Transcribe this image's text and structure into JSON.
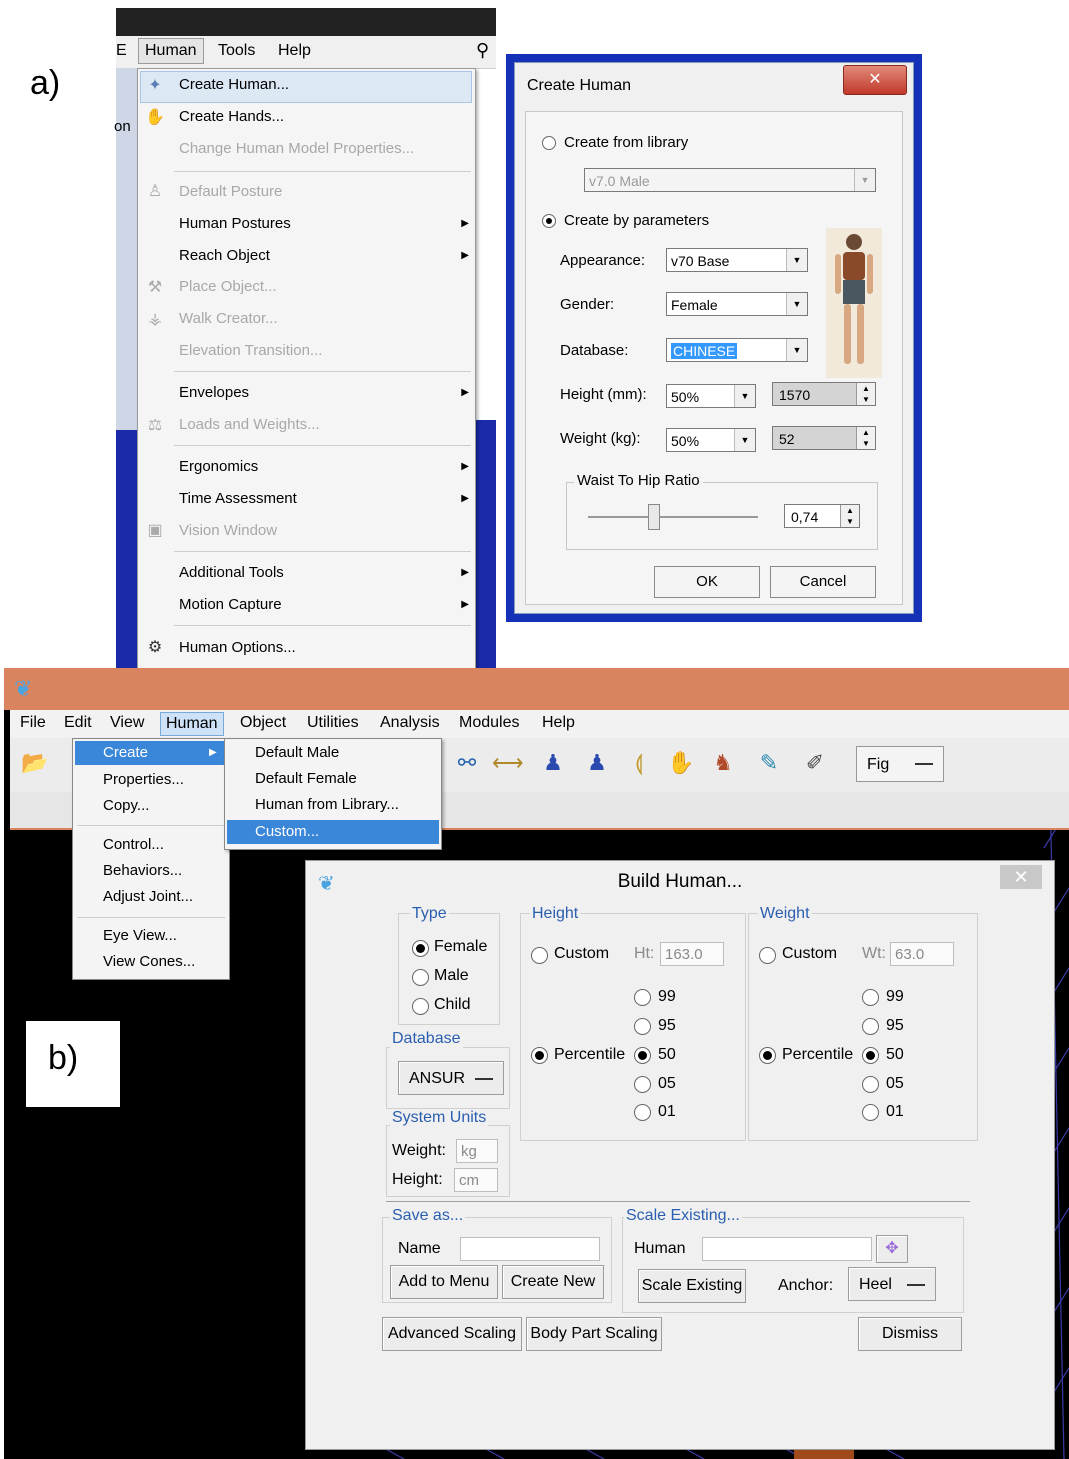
{
  "labels": {
    "a": "a)",
    "b": "b)"
  },
  "a": {
    "menubar": {
      "left_fragment": "E",
      "human": "Human",
      "tools": "Tools",
      "help": "Help"
    },
    "side_fragment": "on",
    "menu": {
      "items": [
        {
          "label": "Create Human...",
          "icon": "create-human-icon",
          "enabled": true
        },
        {
          "label": "Create Hands...",
          "icon": "create-hands-icon",
          "enabled": true
        },
        {
          "label": "Change Human Model Properties...",
          "enabled": false
        },
        {
          "label": "Default Posture",
          "icon": "default-posture-icon",
          "enabled": false
        },
        {
          "label": "Human Postures",
          "enabled": true,
          "submenu": true
        },
        {
          "label": "Reach Object",
          "enabled": true,
          "submenu": true
        },
        {
          "label": "Place Object...",
          "icon": "place-object-icon",
          "enabled": false
        },
        {
          "label": "Walk Creator...",
          "icon": "walk-creator-icon",
          "enabled": false
        },
        {
          "label": "Elevation Transition...",
          "enabled": false
        },
        {
          "label": "Envelopes",
          "enabled": true,
          "submenu": true
        },
        {
          "label": "Loads and Weights...",
          "icon": "weight-icon",
          "enabled": false
        },
        {
          "label": "Ergonomics",
          "enabled": true,
          "submenu": true
        },
        {
          "label": "Time Assessment",
          "enabled": true,
          "submenu": true
        },
        {
          "label": "Vision Window",
          "icon": "vision-window-icon",
          "enabled": false
        },
        {
          "label": "Additional Tools",
          "enabled": true,
          "submenu": true
        },
        {
          "label": "Motion Capture",
          "enabled": true,
          "submenu": true
        },
        {
          "label": "Human Options...",
          "icon": "human-options-icon",
          "enabled": true
        }
      ]
    },
    "dialog": {
      "title": "Create Human",
      "close": "✕",
      "create_from_library": "Create from library",
      "library_value": "v7.0 Male",
      "create_by_parameters": "Create by parameters",
      "appearance_label": "Appearance:",
      "appearance_value": "v70 Base",
      "gender_label": "Gender:",
      "gender_value": "Female",
      "database_label": "Database:",
      "database_value": "CHINESE",
      "height_label": "Height (mm):",
      "height_pct": "50%",
      "height_value": "1570",
      "weight_label": "Weight (kg):",
      "weight_pct": "50%",
      "weight_value": "52",
      "waist_group": "Waist To Hip Ratio",
      "waist_value": "0,74",
      "ok": "OK",
      "cancel": "Cancel"
    }
  },
  "b": {
    "menubar": {
      "file": "File",
      "edit": "Edit",
      "view": "View",
      "human": "Human",
      "object": "Object",
      "utilities": "Utilities",
      "analysis": "Analysis",
      "modules": "Modules",
      "help": "Help"
    },
    "toolbar_fig": "Fig",
    "human_menu": {
      "create": "Create",
      "properties": "Properties...",
      "copy": "Copy...",
      "control": "Control...",
      "behaviors": "Behaviors...",
      "adjust_joint": "Adjust Joint...",
      "eye_view": "Eye View...",
      "view_cones": "View Cones..."
    },
    "create_submenu": {
      "default_male": "Default Male",
      "default_female": "Default Female",
      "human_from_library": "Human from Library...",
      "custom": "Custom..."
    },
    "dialog": {
      "title": "Build Human...",
      "close": "✕",
      "type_group": "Type",
      "female": "Female",
      "male": "Male",
      "child": "Child",
      "database_group": "Database",
      "database_value": "ANSUR",
      "system_units_group": "System Units",
      "weight_unit_label": "Weight:",
      "weight_unit": "kg",
      "height_unit_label": "Height:",
      "height_unit": "cm",
      "height_group": "Height",
      "weight_group": "Weight",
      "custom": "Custom",
      "ht_label": "Ht:",
      "ht_value": "163.0",
      "wt_label": "Wt:",
      "wt_value": "63.0",
      "percentile": "Percentile",
      "p99": "99",
      "p95": "95",
      "p50": "50",
      "p05": "05",
      "p01": "01",
      "save_group": "Save as...",
      "name_label": "Name",
      "add_to_menu": "Add to Menu",
      "create_new": "Create New",
      "scale_group": "Scale Existing...",
      "human_label": "Human",
      "scale_existing_btn": "Scale Existing",
      "anchor_label": "Anchor:",
      "anchor_value": "Heel",
      "advanced_scaling": "Advanced Scaling",
      "body_part_scaling": "Body Part Scaling",
      "dismiss": "Dismiss"
    }
  }
}
